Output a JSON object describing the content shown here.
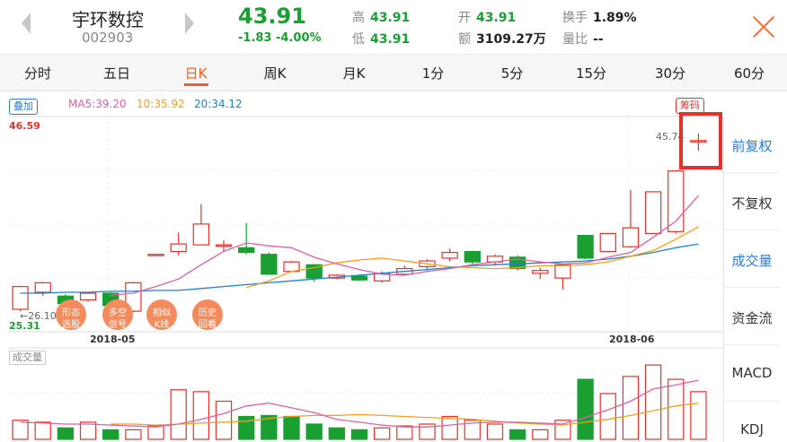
{
  "header": {
    "stock_name": "宇环数控",
    "stock_code": "002903",
    "price": "43.91",
    "change": "-1.83",
    "change_pct": "-4.00%",
    "high_label": "高",
    "high_value": "43.91",
    "low_label": "低",
    "low_value": "43.91",
    "open_label": "开",
    "open_value": "43.91",
    "amount_label": "额",
    "amount_value": "3109.27万",
    "turnover_label": "换手",
    "turnover_value": "1.89%",
    "volratio_label": "量比",
    "volratio_value": "--"
  },
  "tabs": [
    "分时",
    "五日",
    "日K",
    "周K",
    "月K",
    "1分",
    "5分",
    "15分",
    "30分",
    "60分"
  ],
  "active_tab": "日K",
  "overlay_button": "叠加",
  "chips_button": "筹码",
  "ma_legend": {
    "ma5": "MA5:39.20",
    "ma10": "10:35.92",
    "ma20": "20:34.12"
  },
  "chart": {
    "max_label": "46.59",
    "min_label": "25.31",
    "high_mark": "45.74",
    "low_mark": "26.10",
    "date_labels": [
      "2018-05",
      "2018-06"
    ],
    "volume_label": "成交量"
  },
  "circle_buttons": [
    "形态选股",
    "多空信号",
    "相似K线",
    "历史回看"
  ],
  "side_menu": [
    "前复权",
    "不复权",
    "成交量",
    "资金流",
    "MACD",
    "KDJ"
  ],
  "colors": {
    "up": "#e8302a",
    "down": "#1aa032",
    "ma5": "#e060a0",
    "ma10": "#f0a020",
    "ma20": "#2080d0",
    "accent": "#f06020"
  },
  "chart_data": {
    "type": "candlestick",
    "series_price": [
      {
        "o": 27.2,
        "c": 29.6,
        "h": 29.7,
        "l": 27.0,
        "dir": "up"
      },
      {
        "o": 29.0,
        "c": 30.0,
        "h": 30.1,
        "l": 28.6,
        "dir": "up"
      },
      {
        "o": 28.6,
        "c": 27.8,
        "h": 28.8,
        "l": 27.4,
        "dir": "down"
      },
      {
        "o": 28.2,
        "c": 28.9,
        "h": 29.0,
        "l": 28.0,
        "dir": "up"
      },
      {
        "o": 28.9,
        "c": 27.6,
        "h": 29.0,
        "l": 27.4,
        "dir": "down"
      },
      {
        "o": 27.0,
        "c": 30.0,
        "h": 30.1,
        "l": 26.9,
        "dir": "up"
      },
      {
        "o": 33.0,
        "c": 33.0,
        "h": 33.0,
        "l": 33.0,
        "dir": "up"
      },
      {
        "o": 33.3,
        "c": 34.1,
        "h": 35.3,
        "l": 32.9,
        "dir": "up"
      },
      {
        "o": 34.0,
        "c": 36.2,
        "h": 38.3,
        "l": 34.0,
        "dir": "up"
      },
      {
        "o": 34.0,
        "c": 34.0,
        "h": 34.5,
        "l": 33.3,
        "dir": "up"
      },
      {
        "o": 33.7,
        "c": 33.2,
        "h": 36.3,
        "l": 33.0,
        "dir": "down"
      },
      {
        "o": 33.0,
        "c": 30.9,
        "h": 33.2,
        "l": 30.9,
        "dir": "down"
      },
      {
        "o": 31.2,
        "c": 32.2,
        "h": 32.3,
        "l": 31.2,
        "dir": "up"
      },
      {
        "o": 31.9,
        "c": 30.5,
        "h": 32.0,
        "l": 30.1,
        "dir": "down"
      },
      {
        "o": 30.5,
        "c": 30.8,
        "h": 30.9,
        "l": 30.4,
        "dir": "up"
      },
      {
        "o": 30.7,
        "c": 30.3,
        "h": 30.9,
        "l": 30.2,
        "dir": "down"
      },
      {
        "o": 30.2,
        "c": 31.0,
        "h": 31.2,
        "l": 30.0,
        "dir": "up"
      },
      {
        "o": 30.9,
        "c": 31.5,
        "h": 31.8,
        "l": 30.8,
        "dir": "up"
      },
      {
        "o": 31.7,
        "c": 32.3,
        "h": 32.5,
        "l": 31.3,
        "dir": "up"
      },
      {
        "o": 32.6,
        "c": 33.2,
        "h": 33.6,
        "l": 32.3,
        "dir": "up"
      },
      {
        "o": 33.3,
        "c": 32.2,
        "h": 33.4,
        "l": 31.9,
        "dir": "down"
      },
      {
        "o": 32.2,
        "c": 32.8,
        "h": 33.0,
        "l": 31.9,
        "dir": "up"
      },
      {
        "o": 32.7,
        "c": 31.5,
        "h": 32.9,
        "l": 31.3,
        "dir": "down"
      },
      {
        "o": 31.0,
        "c": 31.3,
        "h": 31.6,
        "l": 30.4,
        "dir": "up"
      },
      {
        "o": 30.5,
        "c": 31.9,
        "h": 32.0,
        "l": 29.3,
        "dir": "up"
      },
      {
        "o": 35.0,
        "c": 32.6,
        "h": 35.0,
        "l": 32.5,
        "dir": "down"
      },
      {
        "o": 33.3,
        "c": 35.2,
        "h": 35.2,
        "l": 33.3,
        "dir": "up"
      },
      {
        "o": 33.8,
        "c": 35.8,
        "h": 39.8,
        "l": 33.7,
        "dir": "up"
      },
      {
        "o": 35.2,
        "c": 39.6,
        "h": 39.6,
        "l": 35.2,
        "dir": "up"
      },
      {
        "o": 35.4,
        "c": 41.8,
        "h": 41.8,
        "l": 35.2,
        "dir": "up"
      },
      {
        "o": 45.0,
        "c": 45.0,
        "h": 45.74,
        "l": 43.9,
        "dir": "up"
      }
    ],
    "volume": [
      {
        "v": 20,
        "dir": "up"
      },
      {
        "v": 18,
        "dir": "up"
      },
      {
        "v": 12,
        "dir": "down"
      },
      {
        "v": 18,
        "dir": "up"
      },
      {
        "v": 10,
        "dir": "down"
      },
      {
        "v": 10,
        "dir": "up"
      },
      {
        "v": 14,
        "dir": "up"
      },
      {
        "v": 52,
        "dir": "up"
      },
      {
        "v": 50,
        "dir": "up"
      },
      {
        "v": 40,
        "dir": "up"
      },
      {
        "v": 24,
        "dir": "down"
      },
      {
        "v": 25,
        "dir": "down"
      },
      {
        "v": 24,
        "dir": "down"
      },
      {
        "v": 16,
        "dir": "down"
      },
      {
        "v": 12,
        "dir": "down"
      },
      {
        "v": 10,
        "dir": "down"
      },
      {
        "v": 12,
        "dir": "up"
      },
      {
        "v": 14,
        "dir": "up"
      },
      {
        "v": 16,
        "dir": "up"
      },
      {
        "v": 24,
        "dir": "up"
      },
      {
        "v": 20,
        "dir": "up"
      },
      {
        "v": 16,
        "dir": "up"
      },
      {
        "v": 10,
        "dir": "down"
      },
      {
        "v": 10,
        "dir": "up"
      },
      {
        "v": 20,
        "dir": "up"
      },
      {
        "v": 63,
        "dir": "down"
      },
      {
        "v": 48,
        "dir": "up"
      },
      {
        "v": 66,
        "dir": "up"
      },
      {
        "v": 78,
        "dir": "up"
      },
      {
        "v": 63,
        "dir": "up"
      },
      {
        "v": 50,
        "dir": "up"
      }
    ],
    "ma5": [
      null,
      null,
      null,
      null,
      28.7,
      28.9,
      29.6,
      30.4,
      31.9,
      33.3,
      34.2,
      33.9,
      33.7,
      32.7,
      32.0,
      31.4,
      30.9,
      30.8,
      31.2,
      31.5,
      31.9,
      32.2,
      32.5,
      32.2,
      32.0,
      32.1,
      32.7,
      33.2,
      34.8,
      36.5,
      39.2
    ],
    "ma10": [
      null,
      null,
      null,
      null,
      null,
      null,
      null,
      null,
      null,
      null,
      29.5,
      30.2,
      31.2,
      31.6,
      32.1,
      32.4,
      32.6,
      32.3,
      32.0,
      31.7,
      31.6,
      31.5,
      31.6,
      31.8,
      31.8,
      31.9,
      32.2,
      32.8,
      33.4,
      34.6,
      35.9
    ],
    "ma20": [
      28.9,
      28.9,
      29.0,
      29.0,
      29.1,
      29.1,
      29.2,
      29.2,
      29.4,
      29.6,
      29.8,
      30.0,
      30.2,
      30.4,
      30.6,
      30.8,
      31.0,
      31.2,
      31.4,
      31.6,
      31.8,
      31.9,
      32.0,
      32.1,
      32.2,
      32.3,
      32.5,
      32.8,
      33.2,
      33.7,
      34.1
    ],
    "vol_ma5": [
      18,
      17,
      16,
      16,
      15,
      14,
      13,
      16,
      21,
      27,
      35,
      38,
      33,
      28,
      21,
      18,
      15,
      13,
      13,
      15,
      17,
      18,
      18,
      17,
      16,
      23,
      31,
      40,
      53,
      57,
      62
    ],
    "vol_ma10": [
      null,
      null,
      null,
      null,
      16,
      16,
      15,
      16,
      17,
      18,
      19,
      22,
      24,
      25,
      25,
      26,
      25,
      24,
      23,
      22,
      21,
      19,
      17,
      16,
      15,
      18,
      21,
      25,
      30,
      35,
      38
    ],
    "ylim_price": [
      25.31,
      46.59
    ],
    "date_axis": [
      "2018-05",
      "2018-06"
    ]
  }
}
